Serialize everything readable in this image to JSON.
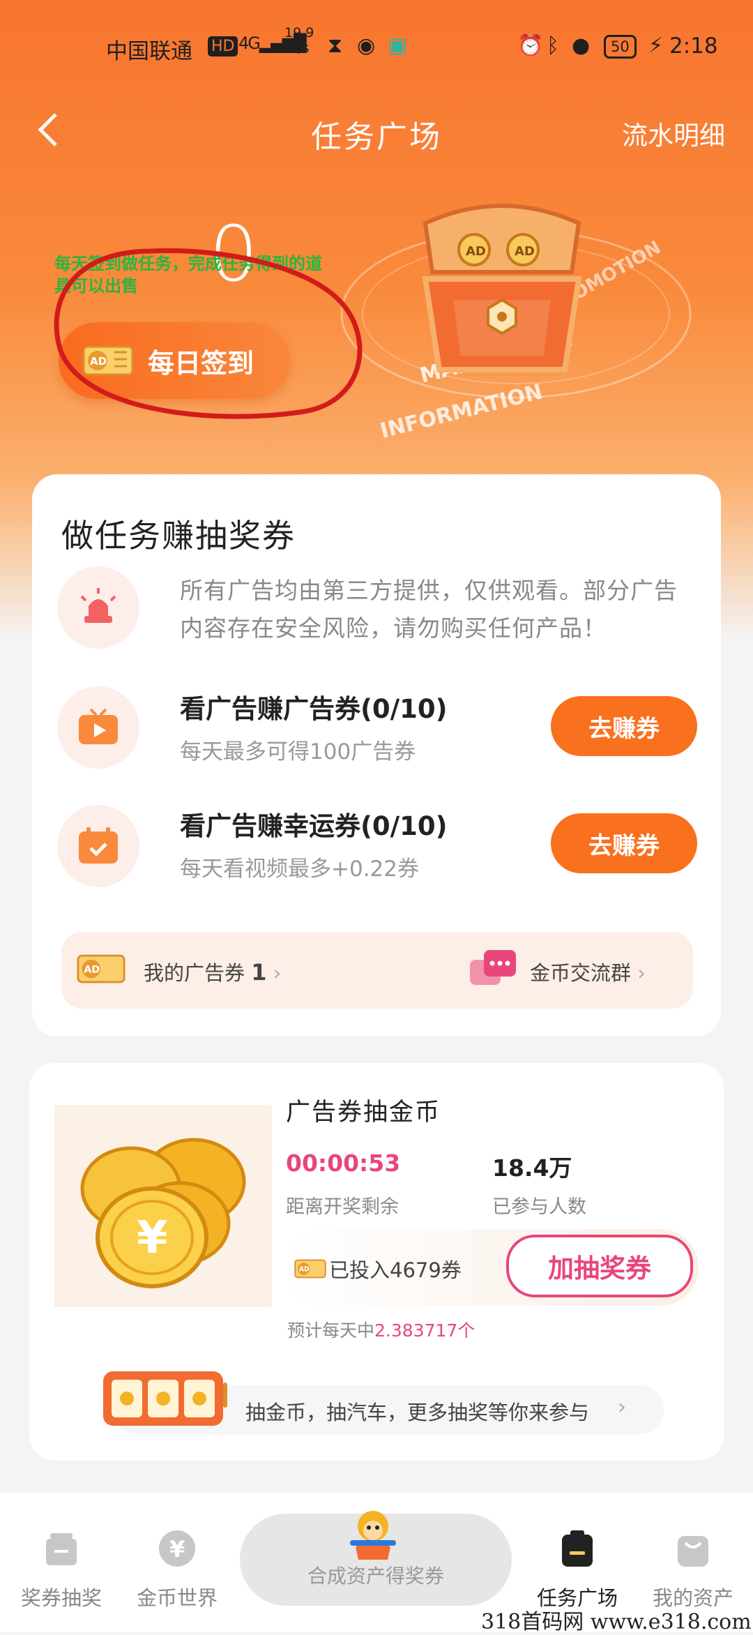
{
  "status_bar": {
    "carrier": "中国联通",
    "net_speed_value": "19.9",
    "net_speed_unit": "K/s",
    "battery": "50",
    "time": "2:18"
  },
  "header": {
    "back_icon": "chevron-left-icon",
    "title": "任务广场",
    "right_link": "流水明细"
  },
  "hero": {
    "signin_count": "0",
    "annotation": "每天签到做任务，完成任务得到的道具可以出售",
    "signin_button": "每日签到",
    "promo_words": [
      "MAKE MONEY",
      "INFORMATION",
      "PROMOTION"
    ]
  },
  "tasks_card": {
    "title": "做任务赚抽奖券",
    "notice": "所有广告均由第三方提供，仅供观看。部分广告内容存在安全风险，请勿购买任何产品！",
    "tasks": [
      {
        "name": "看广告赚广告券(0/10)",
        "sub": "每天最多可得100广告券",
        "button": "去赚券",
        "icon": "tv-play-icon"
      },
      {
        "name": "看广告赚幸运券(0/10)",
        "sub": "每天看视频最多+0.22券",
        "button": "去赚券",
        "icon": "calendar-check-icon"
      }
    ],
    "my_coupons_label": "我的广告券",
    "my_coupons_count": "1",
    "group_label": "金币交流群"
  },
  "lottery_card": {
    "title": "广告券抽金币",
    "countdown": "00:00:53",
    "countdown_label": "距离开奖剩余",
    "participants": "18.4万",
    "participants_label": "已参与人数",
    "invested": "已投入4679券",
    "add_button": "加抽奖券",
    "daily_prefix": "预计每天中",
    "daily_value": "2.383717个",
    "promo_text": "抽金币，抽汽车，更多抽奖等你来参与"
  },
  "tab_bar": {
    "items": [
      {
        "label": "奖券抽奖",
        "icon": "gift-icon"
      },
      {
        "label": "金币世界",
        "icon": "yen-coin-icon"
      },
      {
        "label": "任务广场",
        "icon": "clipboard-icon",
        "active": true
      },
      {
        "label": "我的资产",
        "icon": "bag-icon"
      }
    ],
    "center_label": "合成资产得奖券"
  },
  "watermark": "318首码网 www.e318.com",
  "colors": {
    "brand_orange": "#f9701e",
    "accent_pink": "#e8467a"
  }
}
